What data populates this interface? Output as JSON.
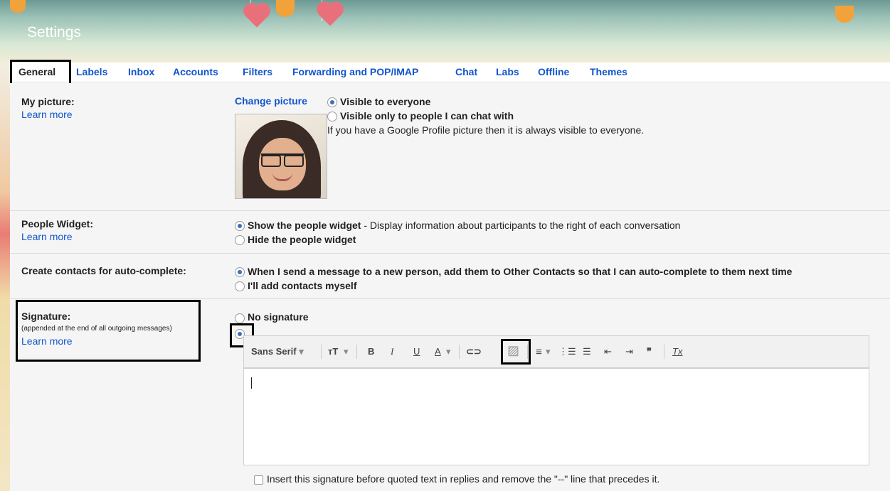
{
  "header": {
    "title": "Settings"
  },
  "tabs": [
    {
      "label": "General",
      "active": true
    },
    {
      "label": "Labels"
    },
    {
      "label": "Inbox"
    },
    {
      "label": "Accounts"
    },
    {
      "label": "Filters"
    },
    {
      "label": "Forwarding and POP/IMAP"
    },
    {
      "label": "Chat"
    },
    {
      "label": "Labs"
    },
    {
      "label": "Offline"
    },
    {
      "label": "Themes"
    }
  ],
  "my_picture": {
    "label": "My picture:",
    "learn_more": "Learn more",
    "change_link": "Change picture",
    "options": [
      {
        "label": "Visible to everyone",
        "selected": true
      },
      {
        "label": "Visible only to people I can chat with",
        "selected": false
      }
    ],
    "note": "If you have a Google Profile picture then it is always visible to everyone."
  },
  "people_widget": {
    "label": "People Widget:",
    "learn_more": "Learn more",
    "options": [
      {
        "label": "Show the people widget",
        "desc": " - Display information about participants to the right of each conversation",
        "selected": true
      },
      {
        "label": "Hide the people widget",
        "desc": "",
        "selected": false
      }
    ]
  },
  "contacts": {
    "label": "Create contacts for auto-complete:",
    "options": [
      {
        "label": "When I send a message to a new person, add them to Other Contacts so that I can auto-complete to them next time",
        "selected": true
      },
      {
        "label": "I'll add contacts myself",
        "selected": false
      }
    ]
  },
  "signature": {
    "label": "Signature:",
    "note": "(appended at the end of all outgoing messages)",
    "learn_more": "Learn more",
    "no_signature": "No signature",
    "custom_selected": true,
    "toolbar": {
      "font": "Sans Serif",
      "font_caret": "▾",
      "size_icon": "ᴛT",
      "bold": "B",
      "italic": "I",
      "underline": "U",
      "text_color": "A",
      "link_icon": "⊂⊃",
      "image_icon": "▨",
      "align_icon": "≡",
      "numbered_icon": "⋮☰",
      "bullet_icon": "☰",
      "indent_less_icon": "⇤",
      "indent_more_icon": "⇥",
      "quote_icon": "❞",
      "clear_format_icon": "Tx"
    },
    "insert_before_quoted": "Insert this signature before quoted text in replies and remove the \"--\" line that precedes it."
  },
  "colors": {
    "link": "#1155cc",
    "highlight_border": "#000000",
    "radio_dot": "#3d6fb5"
  }
}
